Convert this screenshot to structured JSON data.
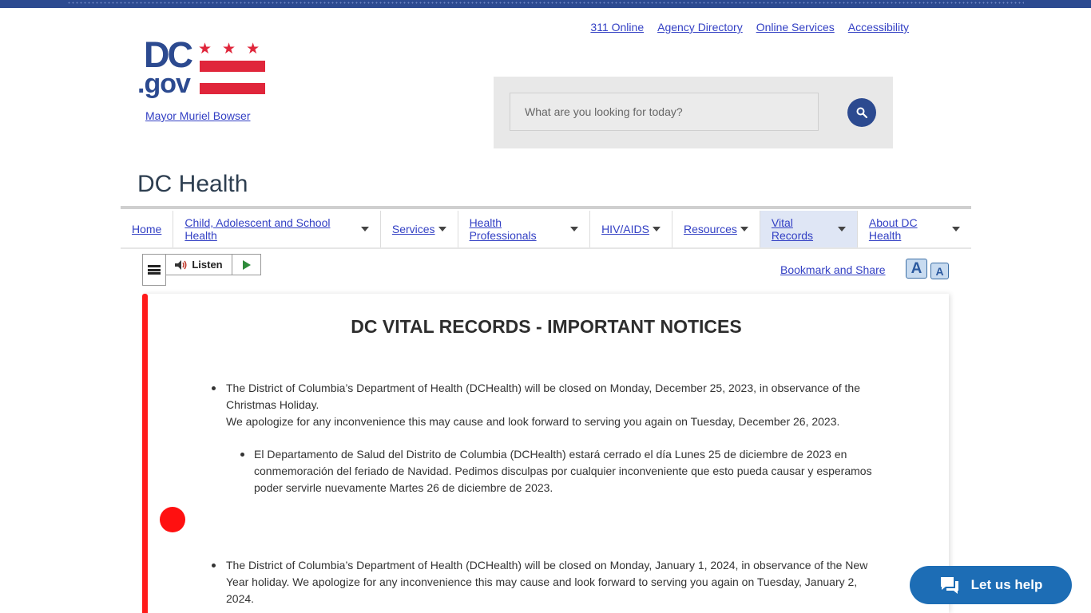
{
  "utility_links": [
    "311 Online",
    "Agency Directory",
    "Online Services",
    "Accessibility"
  ],
  "logo": {
    "dc": "DC",
    "gov": ".gov",
    "stars": "★★★"
  },
  "mayor_link": "Mayor Muriel Bowser",
  "search": {
    "placeholder": "What are you looking for today?"
  },
  "site_title": "DC Health",
  "nav": [
    {
      "label": "Home",
      "dropdown": false,
      "active": false
    },
    {
      "label": "Child, Adolescent and School Health",
      "dropdown": true,
      "active": false
    },
    {
      "label": "Services",
      "dropdown": true,
      "active": false
    },
    {
      "label": "Health Professionals",
      "dropdown": true,
      "active": false
    },
    {
      "label": "HIV/AIDS",
      "dropdown": true,
      "active": false
    },
    {
      "label": "Resources",
      "dropdown": true,
      "active": false
    },
    {
      "label": "Vital Records",
      "dropdown": true,
      "active": true
    },
    {
      "label": "About DC Health",
      "dropdown": true,
      "active": false
    }
  ],
  "toolbar": {
    "listen_label": "Listen",
    "bookmark_label": "Bookmark and Share",
    "font_large": "A",
    "font_small": "A"
  },
  "content": {
    "title": "DC VITAL RECORDS - IMPORTANT NOTICES",
    "notice1_line1": "The District of Columbia’s Department of Health (DCHealth) will be closed on Monday, December 25, 2023, in observance of the Christmas Holiday.",
    "notice1_line2": "We apologize for any inconvenience this may cause and look forward to serving you again on Tuesday, December 26, 2023.",
    "notice2": "El Departamento de Salud del Distrito de Columbia (DCHealth) estará cerrado el día Lunes 25 de diciembre de 2023 en conmemoración del feriado de Navidad.  Pedimos disculpas por cualquier inconveniente que esto pueda causar y esperamos poder servirle nuevamente Martes 26 de diciembre de 2023.",
    "notice3": "The District of Columbia’s Department of Health (DCHealth) will be closed on Monday, January 1, 2024, in observance of the New Year holiday.  We apologize for any inconvenience this may cause and look forward to serving you again on Tuesday, January  2, 2024."
  },
  "help_button": "Let us help",
  "colors": {
    "brand_blue": "#2c4a90",
    "brand_red": "#e0263b",
    "link": "#3340c4",
    "help_blue": "#1d6db5"
  }
}
